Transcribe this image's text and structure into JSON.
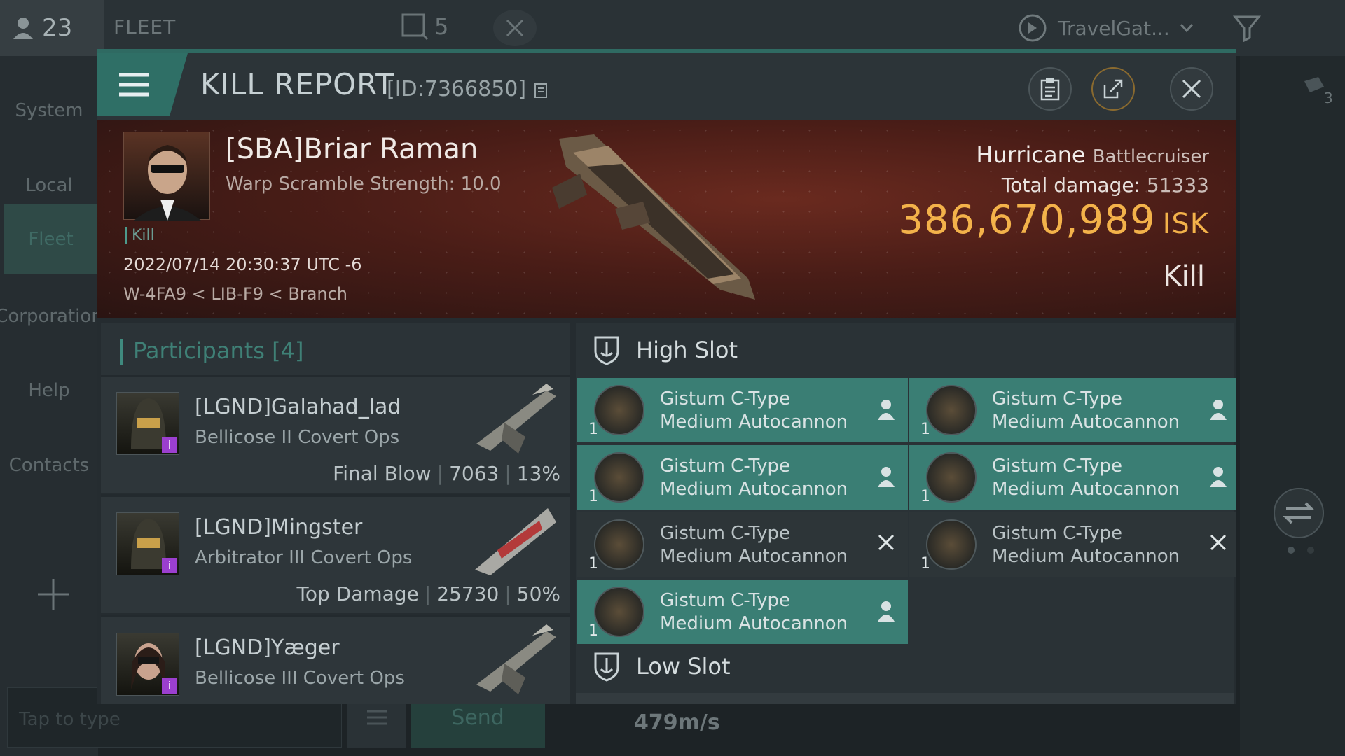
{
  "topbar": {
    "online_count": "23",
    "fleet_label": "FLEET",
    "window_count": "5",
    "travel_label": "TravelGat..."
  },
  "sidebar": {
    "items": [
      {
        "label": "System"
      },
      {
        "label": "Local"
      },
      {
        "label": "Fleet"
      },
      {
        "label": "Corporation"
      },
      {
        "label": "Help"
      },
      {
        "label": "Contacts"
      }
    ]
  },
  "chat": {
    "placeholder": "Tap to type",
    "send_label": "Send"
  },
  "hud": {
    "speed": "479m/s",
    "side_count": "3"
  },
  "report": {
    "title": "KILL REPORT",
    "id": "[ID:7366850]",
    "pilot": {
      "name": "[SBA]Briar Raman",
      "stat": "Warp Scramble Strength: 10.0",
      "tag": "Kill"
    },
    "date": "2022/07/14 20:30:37 UTC -6",
    "location": "W-4FA9 < LIB-F9 < Branch",
    "ship": {
      "name": "Hurricane",
      "class": "Battlecruiser"
    },
    "total_damage_label": "Total damage:",
    "total_damage": "51333",
    "isk_value": "386,670,989",
    "isk_unit": "ISK",
    "result": "Kill"
  },
  "participants": {
    "title": "Participants [4]",
    "rows": [
      {
        "name": "[LGND]Galahad_lad",
        "ship": "Bellicose II Covert Ops",
        "label": "Final Blow",
        "damage": "7063",
        "percent": "13%"
      },
      {
        "name": "[LGND]Mingster",
        "ship": "Arbitrator III Covert Ops",
        "label": "Top Damage",
        "damage": "25730",
        "percent": "50%"
      },
      {
        "name": "[LGND]Yæger",
        "ship": "Bellicose III Covert Ops",
        "label": "",
        "damage": "",
        "percent": ""
      }
    ]
  },
  "slots": {
    "high_label": "High Slot",
    "low_label": "Low Slot",
    "modules": [
      {
        "line1": "Gistum C-Type",
        "line2": "Medium Autocannon",
        "qty": "1",
        "state": "fitted"
      },
      {
        "line1": "Gistum C-Type",
        "line2": "Medium Autocannon",
        "qty": "1",
        "state": "fitted"
      },
      {
        "line1": "Gistum C-Type",
        "line2": "Medium Autocannon",
        "qty": "1",
        "state": "fitted"
      },
      {
        "line1": "Gistum C-Type",
        "line2": "Medium Autocannon",
        "qty": "1",
        "state": "fitted"
      },
      {
        "line1": "Gistum C-Type",
        "line2": "Medium Autocannon",
        "qty": "1",
        "state": "destroyed"
      },
      {
        "line1": "Gistum C-Type",
        "line2": "Medium Autocannon",
        "qty": "1",
        "state": "destroyed"
      },
      {
        "line1": "Gistum C-Type",
        "line2": "Medium Autocannon",
        "qty": "1",
        "state": "fitted"
      }
    ]
  },
  "colors": {
    "accent": "#2f6f66",
    "isk": "#f3b24a",
    "fitted": "#3a7e74"
  }
}
